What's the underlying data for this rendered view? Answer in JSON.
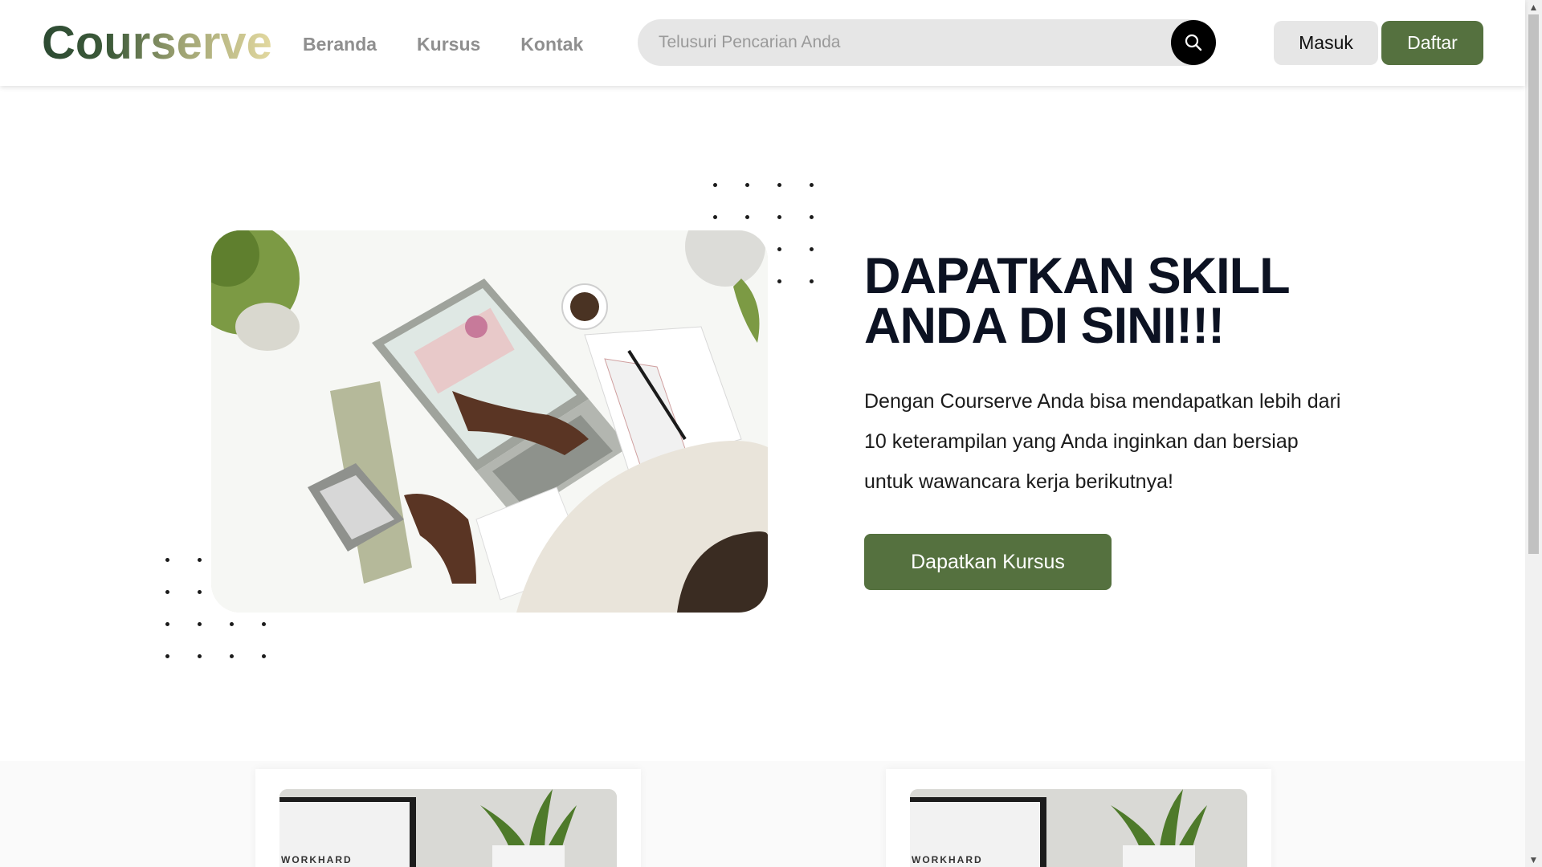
{
  "header": {
    "logo": "Courserve",
    "nav": [
      {
        "label": "Beranda"
      },
      {
        "label": "Kursus"
      },
      {
        "label": "Kontak"
      }
    ],
    "search": {
      "placeholder": "Telusuri Pencarian Anda",
      "icon": "search-icon"
    },
    "login_label": "Masuk",
    "register_label": "Daftar"
  },
  "hero": {
    "title": "DAPATKAN SKILL ANDA DI SINI!!!",
    "description": "Dengan Courserve Anda bisa mendapatkan lebih dari 10 keterampilan yang Anda inginkan dan bersiap untuk wawancara kerja berikutnya!",
    "cta_label": "Dapatkan Kursus"
  },
  "courses": [
    {
      "image_text": "WORKHARD"
    },
    {
      "image_text": "WORKHARD"
    }
  ],
  "colors": {
    "primary_green": "#55713f",
    "logo_dark": "#2c4a32",
    "logo_light": "#e3d9a0",
    "title": "#0c1222"
  }
}
